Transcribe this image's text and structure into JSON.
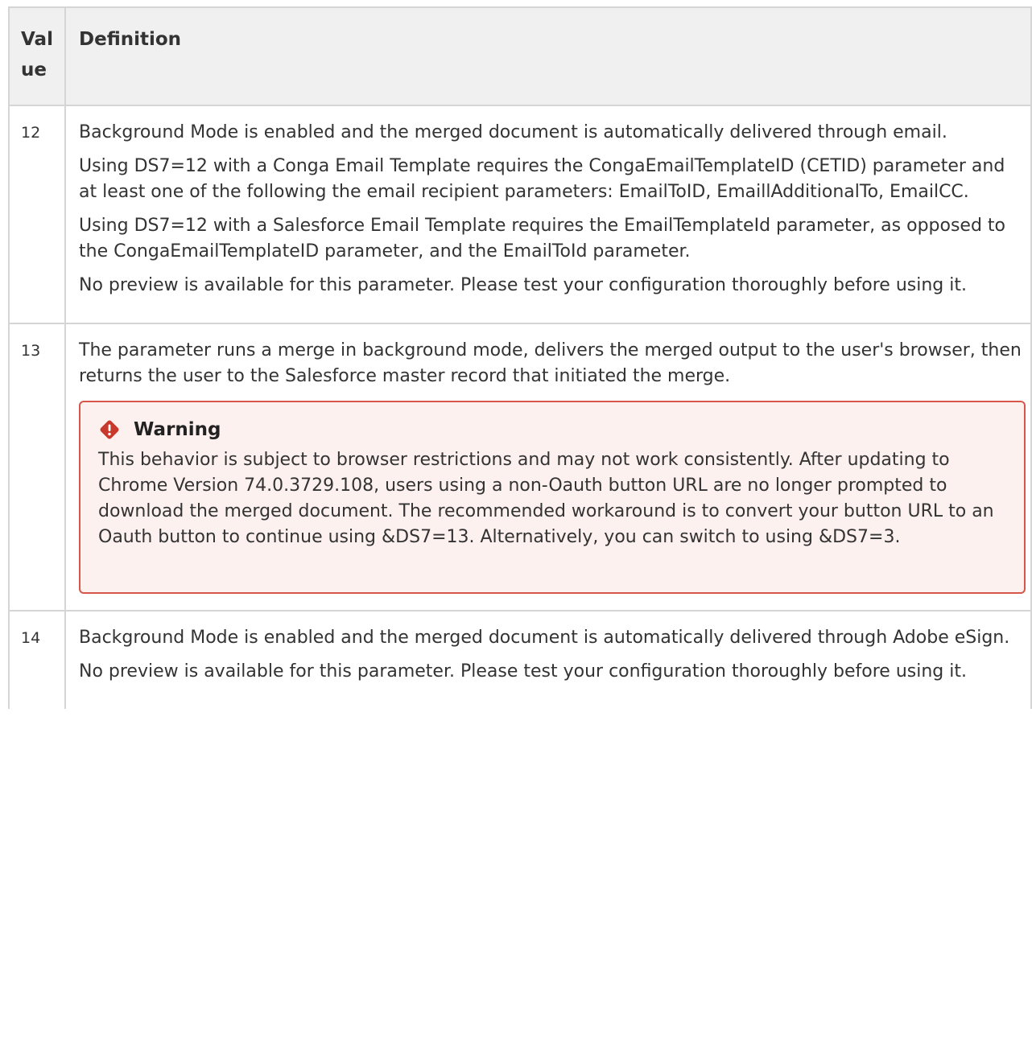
{
  "table": {
    "header": {
      "value": "Value",
      "definition": "Definition"
    },
    "rows": [
      {
        "value": "12",
        "paragraphs": [
          "Background Mode is enabled and the merged document is automatically delivered through email.",
          "Using DS7=12 with a Conga Email Template requires the CongaEmailTemplateID (CETID) parameter and at least one of the following the email recipient parameters: EmailToID, EmaillAdditionalTo, EmailCC.",
          "Using DS7=12 with a Salesforce Email Template requires the EmailTemplateId parameter, as opposed to the CongaEmailTemplateID parameter, and the EmailToId parameter.",
          "No preview is available for this parameter. Please test your configuration thoroughly before using it."
        ]
      },
      {
        "value": "13",
        "paragraphs": [
          "The parameter runs a merge in background mode, delivers the merged output to the user's browser, then returns the user to the Salesforce master record that initiated the merge."
        ],
        "warning": {
          "icon": "warning-diamond-icon",
          "title": "Warning",
          "text": "This behavior is subject to browser restrictions and may not work consistently. After updating to Chrome Version 74.0.3729.108, users using a non-Oauth button URL are no longer prompted to download the merged document. The recommended workaround is to convert your button URL to an Oauth button to continue using &DS7=13. Alternatively, you can switch to using &DS7=3."
        }
      },
      {
        "value": "14",
        "paragraphs": [
          "Background Mode is enabled and the merged document is automatically delivered through Adobe eSign.",
          "No preview is available for this parameter. Please test your configuration thoroughly before using it."
        ]
      }
    ]
  },
  "colors": {
    "border": "#d5d5d5",
    "header_bg": "#f0f0f0",
    "warning_border": "#d6564a",
    "warning_bg": "#fdf1f0",
    "warning_icon": "#c8382b"
  }
}
